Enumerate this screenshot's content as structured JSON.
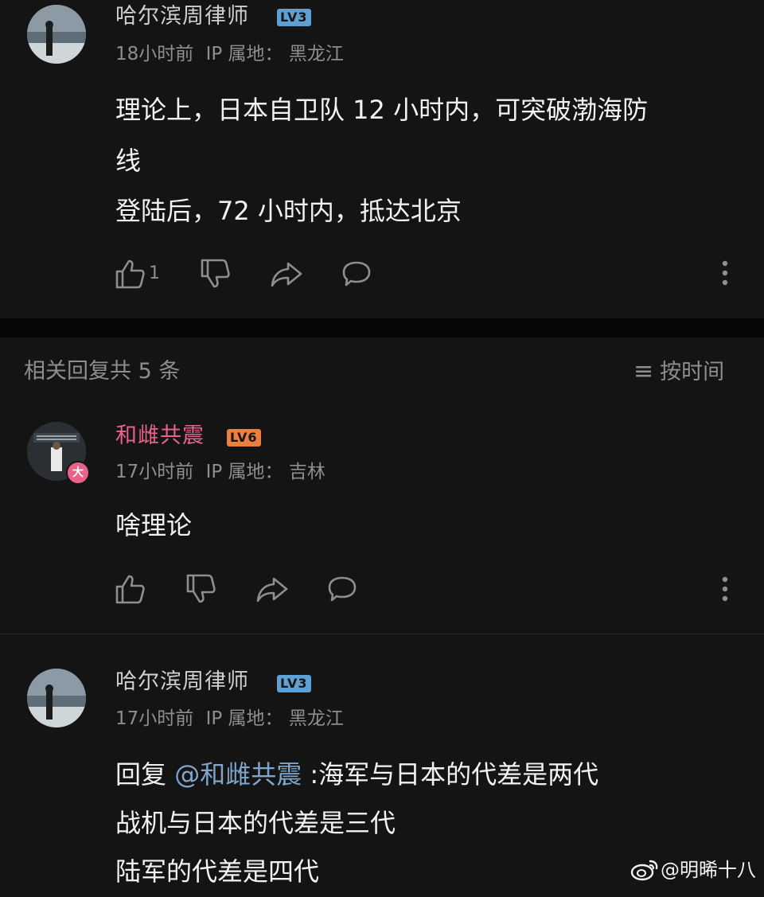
{
  "comments": [
    {
      "author": "哈尔滨周律师",
      "level": "LV3",
      "time": "18小时前",
      "ip_label": "IP 属地：",
      "ip_location": "黑龙江",
      "lines": [
        "理论上，日本自卫队 12 小时内，可突破渤海防",
        "线",
        "登陆后，72 小时内，抵达北京"
      ],
      "like_count": "1"
    },
    {
      "author": "和雌共震",
      "level": "LV6",
      "time": "17小时前",
      "ip_label": "IP 属地：",
      "ip_location": "吉林",
      "badge": "大",
      "lines": [
        "啥理论"
      ]
    },
    {
      "author": "哈尔滨周律师",
      "level": "LV3",
      "time": "17小时前",
      "ip_label": "IP 属地：",
      "ip_location": "黑龙江",
      "reply_prefix": "回复",
      "mention": "@和雌共震",
      "reply_line1_rest": ":海军与日本的代差是两代",
      "lines": [
        "战机与日本的代差是三代",
        "陆军的代差是四代"
      ]
    }
  ],
  "replies_header": {
    "title": "相关回复共 5 条",
    "sort_icon": "≡",
    "sort_label": "按时间"
  },
  "watermark": "@明晞十八",
  "colors": {
    "background": "#141414",
    "name_default": "#cfcfcf",
    "name_vip": "#e8628a",
    "mention": "#7fa6cc",
    "lv3": "#5e9fd4",
    "lv6": "#ef7d3b"
  }
}
